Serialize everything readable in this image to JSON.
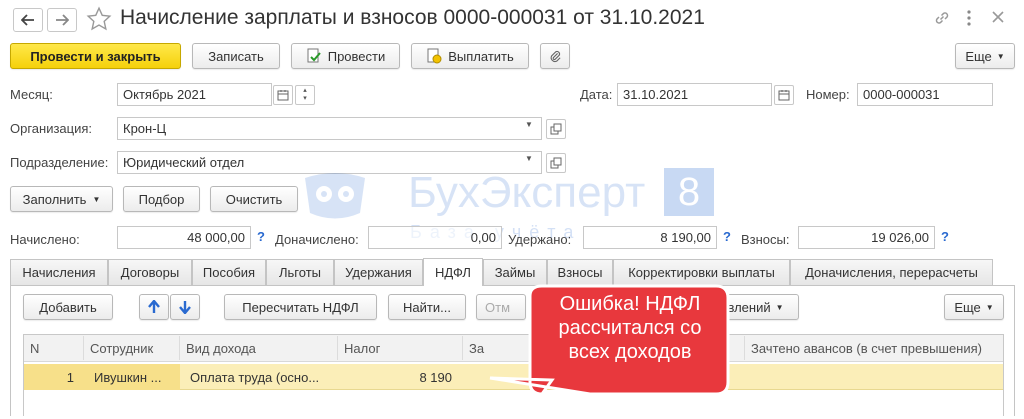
{
  "window": {
    "title": "Начисление зарплаты и взносов 0000-000031 от 31.10.2021",
    "icons": [
      "arrow-left-icon",
      "arrow-right-icon",
      "star-icon",
      "link-icon",
      "more-vertical-icon",
      "close-icon"
    ]
  },
  "toolbar": {
    "post_close": "Провести и закрыть",
    "save": "Записать",
    "post": "Провести",
    "pay": "Выплатить",
    "more": "Еще"
  },
  "form": {
    "month_label": "Месяц:",
    "month_value": "Октябрь 2021",
    "date_label": "Дата:",
    "date_value": "31.10.2021",
    "number_label": "Номер:",
    "number_value": "0000-000031",
    "org_label": "Организация:",
    "org_value": "Крон-Ц",
    "dept_label": "Подразделение:",
    "dept_value": "Юридический отдел"
  },
  "actions": {
    "fill": "Заполнить",
    "select": "Подбор",
    "clear": "Очистить"
  },
  "totals": {
    "accrued_label": "Начислено:",
    "accrued_value": "48 000,00",
    "extra_label": "Доначислено:",
    "extra_value": "0,00",
    "withheld_label": "Удержано:",
    "withheld_value": "8 190,00",
    "contrib_label": "Взносы:",
    "contrib_value": "19 026,00",
    "help": "?"
  },
  "tabs": [
    "Начисления",
    "Договоры",
    "Пособия",
    "Льготы",
    "Удержания",
    "НДФЛ",
    "Займы",
    "Взносы",
    "Корректировки выплаты",
    "Доначисления, перерасчеты"
  ],
  "active_tab": "НДФЛ",
  "tab_toolbar": {
    "add": "Добавить",
    "recalc": "Пересчитать НДФЛ",
    "find": "Найти...",
    "cancel_partial": "Отм",
    "deductions_partial": "влений",
    "more": "Еще"
  },
  "table": {
    "columns": [
      "N",
      "Сотрудник",
      "Вид дохода",
      "Налог",
      "За",
      "Зачтено авансов (в счет превышения)"
    ],
    "rows": [
      {
        "n": "1",
        "employee": "Ивушкин ...",
        "income": "Оплата труда (осно...",
        "tax": "8 190"
      }
    ]
  },
  "callout": {
    "text_line1": "Ошибка! НДФЛ",
    "text_line2": "рассчитался со",
    "text_line3": "всех доходов",
    "color": "#e8383d"
  },
  "watermark": {
    "brand": "БухЭксперт",
    "number": "8",
    "tagline": "База учёта"
  }
}
